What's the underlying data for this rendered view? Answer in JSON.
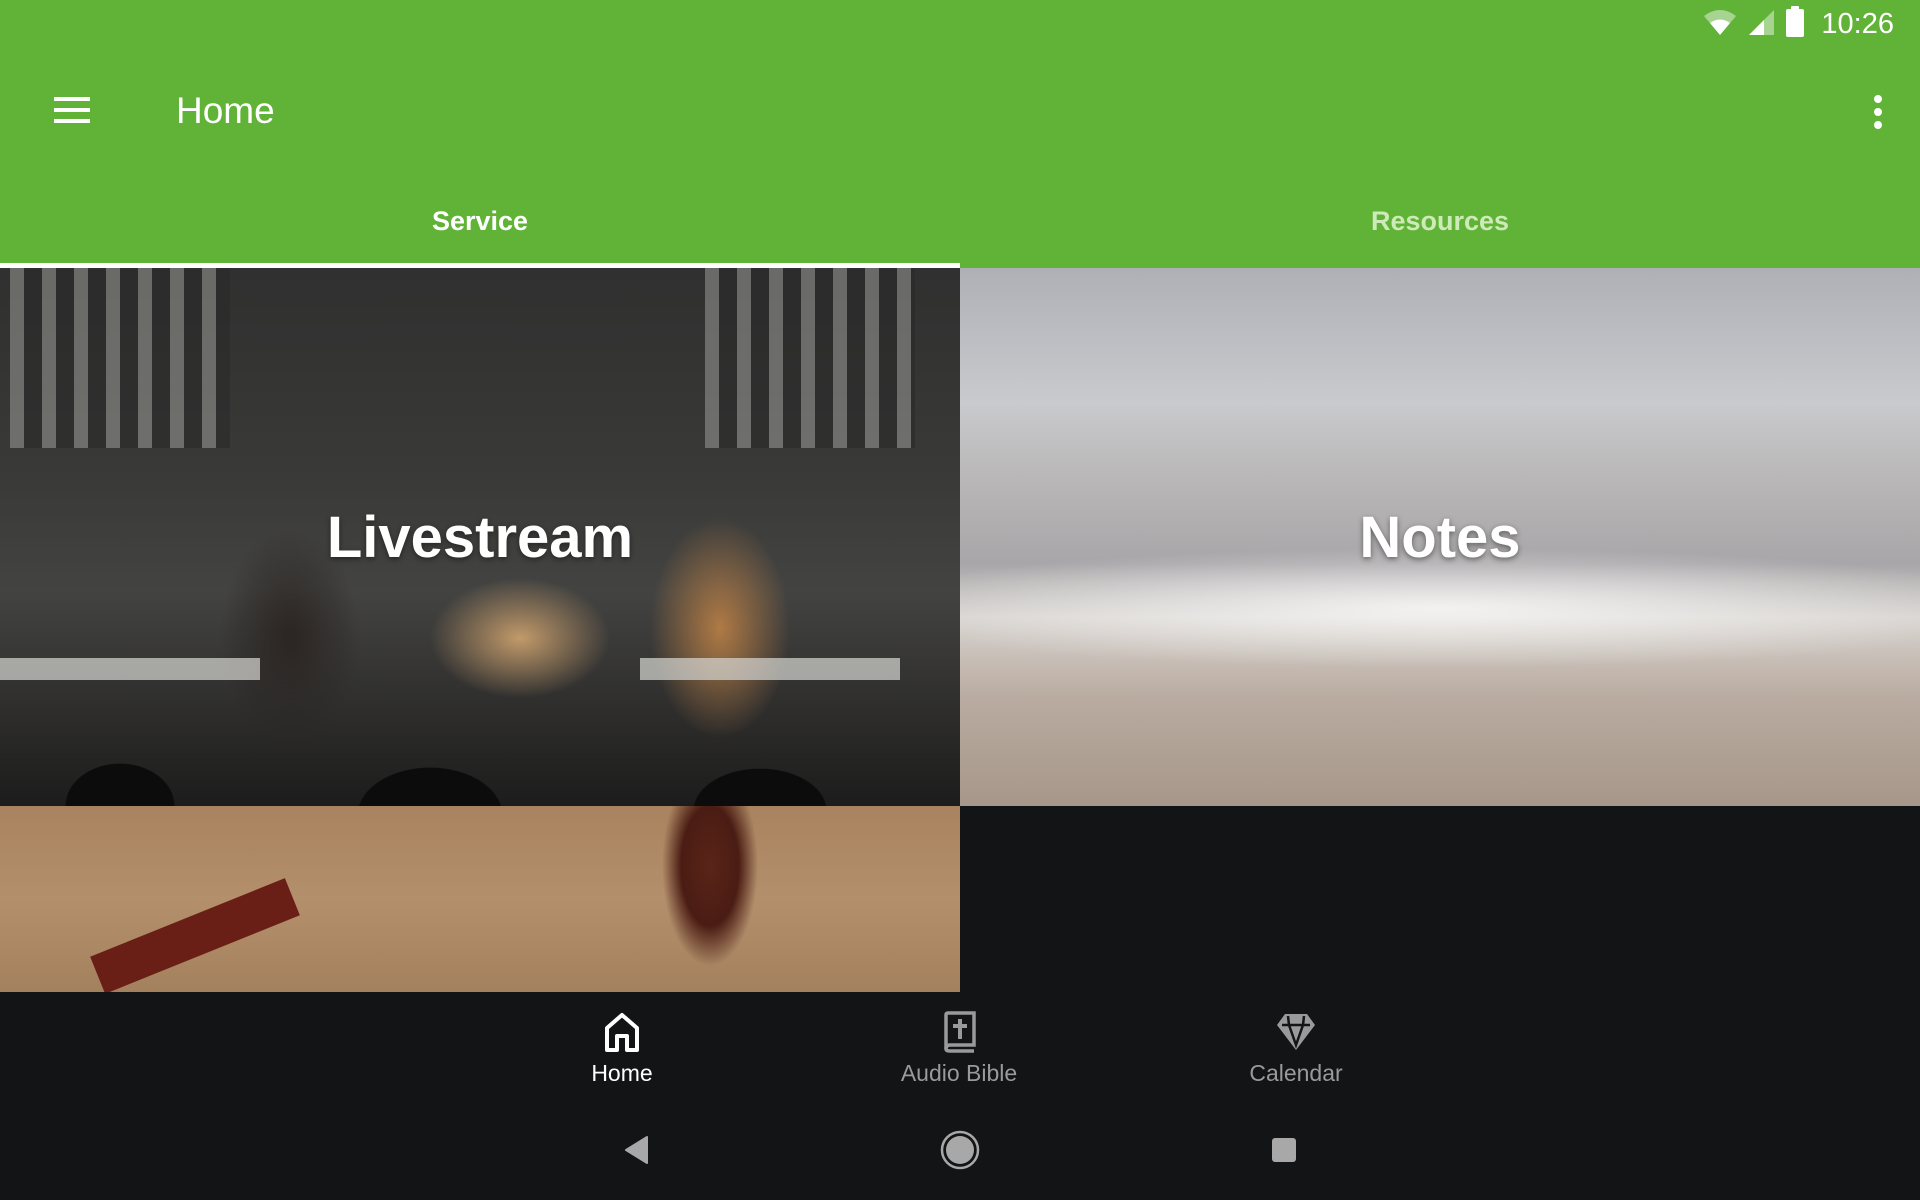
{
  "status_bar": {
    "time": "10:26",
    "icons": [
      "wifi-icon",
      "cellular-signal-icon",
      "battery-icon"
    ]
  },
  "app_bar": {
    "title": "Home",
    "menu_icon": "hamburger-menu-icon",
    "overflow_icon": "more-vert-icon",
    "background_color": "#60b337"
  },
  "tabs": [
    {
      "label": "Service",
      "active": true
    },
    {
      "label": "Resources",
      "active": false
    }
  ],
  "tiles": [
    {
      "label": "Livestream",
      "image": "worship-band-on-stage"
    },
    {
      "label": "Notes",
      "image": "ocean-waves-with-surfers"
    },
    {
      "label": "",
      "image": "open-bible-with-ribbon"
    }
  ],
  "bottom_nav": [
    {
      "label": "Home",
      "icon": "home-icon",
      "active": true
    },
    {
      "label": "Audio Bible",
      "icon": "bible-icon",
      "active": false
    },
    {
      "label": "Calendar",
      "icon": "diamond-icon",
      "active": false
    }
  ],
  "system_nav": [
    "back-icon",
    "home-circle-icon",
    "recents-icon"
  ]
}
